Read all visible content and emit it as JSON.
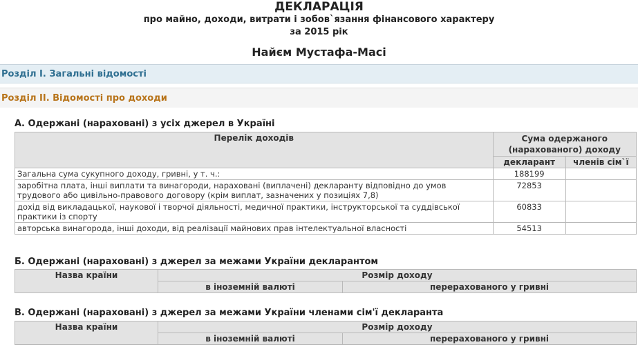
{
  "header": {
    "title": "ДЕКЛАРАЦІЯ",
    "subtitle1": "про майно, доходи, витрати і зобов`язання фінансового характеру",
    "subtitle2": "за 2015 рік",
    "person": "Найєм Мустафа-Масі"
  },
  "sections": {
    "s1": "Розділ I. Загальні відомості",
    "s2": "Розділ II. Відомості про доходи"
  },
  "partA": {
    "title": "А. Одержані (нараховані) з усіх джерел в Україні",
    "col_list": "Перелік доходів",
    "col_sum": "Сума одержаного (нарахованого) доходу",
    "col_declarant": "декларант",
    "col_family": "членів сім`ї",
    "rows": [
      {
        "label": "Загальна сума сукупного доходу, гривні, у т. ч.:",
        "declarant": "188199",
        "family": ""
      },
      {
        "label": "заробітна плата, інші виплати та винагороди, нараховані (виплачені) декларанту відповідно до умов трудового або цивільно-правового договору (крім виплат, зазначених у позиціях 7,8)",
        "declarant": "72853",
        "family": ""
      },
      {
        "label": "дохід від викладацької, наукової і творчої діяльності, медичної практики, інструкторської та суддівської практики із спорту",
        "declarant": "60833",
        "family": ""
      },
      {
        "label": "авторська винагорода, інші доходи, від реалізації майнових прав інтелектуальної власності",
        "declarant": "54513",
        "family": ""
      }
    ]
  },
  "partB": {
    "title": "Б. Одержані (нараховані) з джерел за межами України декларантом",
    "col_country": "Назва країни",
    "col_size": "Розмір доходу",
    "col_foreign": "в іноземній валюті",
    "col_uah": "перерахованого у гривні"
  },
  "partC": {
    "title": "В. Одержані (нараховані) з джерел за межами України членами сім'ї декларанта",
    "col_country": "Назва країни",
    "col_size": "Розмір доходу",
    "col_foreign": "в іноземній валюті",
    "col_uah": "перерахованого у гривні"
  }
}
